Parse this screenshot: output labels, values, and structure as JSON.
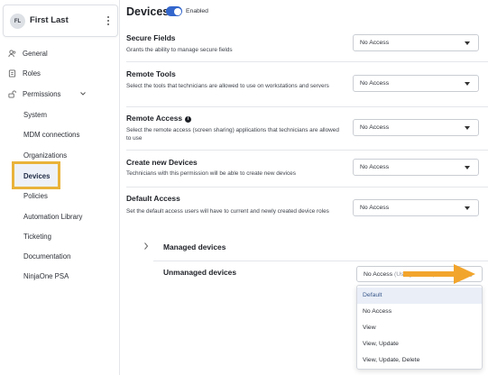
{
  "sidebar": {
    "user": {
      "initials": "FL",
      "name": "First Last"
    },
    "items": [
      {
        "label": "General",
        "icon": "users-icon"
      },
      {
        "label": "Roles",
        "icon": "id-card-icon"
      },
      {
        "label": "Permissions",
        "icon": "key-icon"
      }
    ],
    "sub_items": [
      {
        "label": "System"
      },
      {
        "label": "MDM connections"
      },
      {
        "label": "Organizations"
      },
      {
        "label": "Devices"
      },
      {
        "label": "Policies"
      },
      {
        "label": "Automation Library"
      },
      {
        "label": "Ticketing"
      },
      {
        "label": "Documentation"
      },
      {
        "label": "NinjaOne PSA"
      }
    ]
  },
  "header": {
    "title": "Devices",
    "toggle_label": "Enabled"
  },
  "rows": [
    {
      "title": "Secure Fields",
      "desc": "Grants the ability to manage secure fields",
      "value": "No Access"
    },
    {
      "title": "Remote Tools",
      "desc": "Select the tools that technicians are allowed to use on workstations and servers",
      "value": "No Access"
    },
    {
      "title": "Remote Access",
      "desc": "Select the remote access (screen sharing) applications that technicians are allowed to use",
      "value": "No Access"
    },
    {
      "title": "Create new Devices",
      "desc": "Technicians with this permission will be able to create new devices",
      "value": "No Access"
    },
    {
      "title": "Default Access",
      "desc": "Set the default access users will have to current and newly created device roles",
      "value": "No Access"
    }
  ],
  "managed": {
    "label": "Managed devices"
  },
  "unmanaged": {
    "label": "Unmanaged devices",
    "value": "No Access",
    "value_suffix": "(Using Default)"
  },
  "dropdown_options": [
    "Default",
    "No Access",
    "View",
    "View, Update",
    "View, Update, Delete"
  ],
  "colors": {
    "accent": "#3366cc",
    "highlight": "#e9b33a",
    "arrow": "#f2a52c",
    "selected_bg": "#e9eef7"
  }
}
